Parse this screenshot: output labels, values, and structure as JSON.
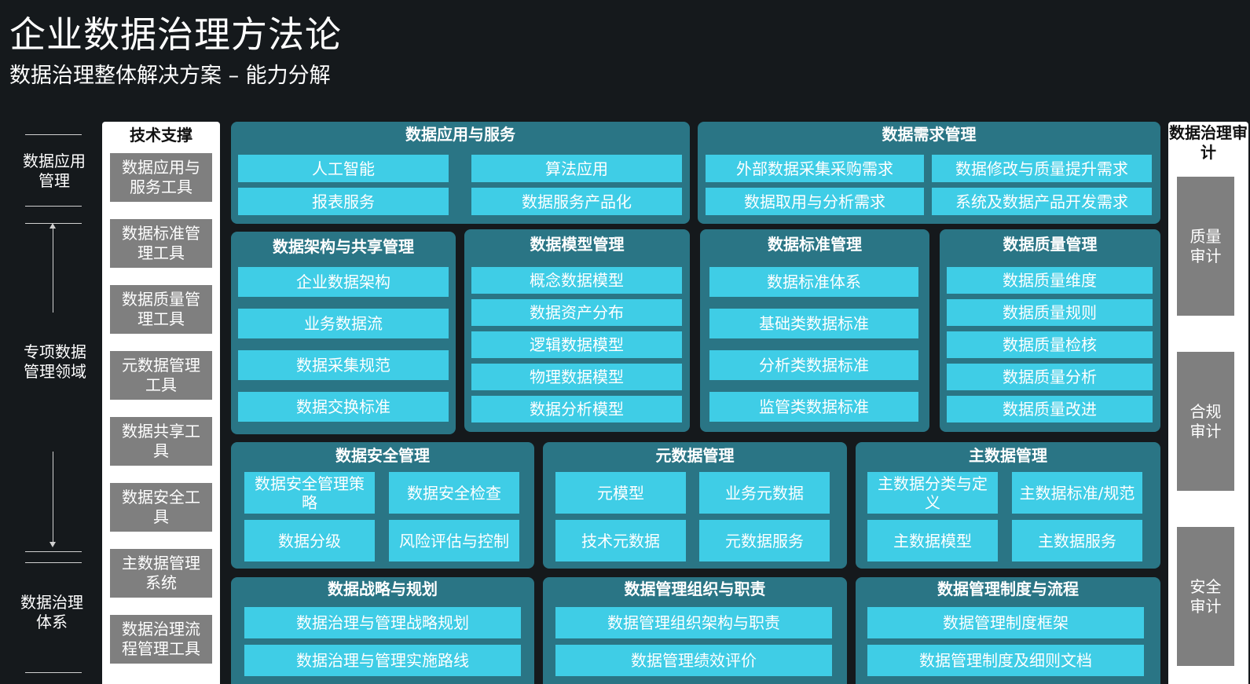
{
  "title": "企业数据治理方法论",
  "subtitle": "数据治理整体解决方案 – 能力分解",
  "axis": {
    "top_label": "数据应用管理",
    "middle_label": "专项数据管理领域",
    "bottom_label": "数据治理体系"
  },
  "tech_support": {
    "header": "技术支撑",
    "items": [
      "数据应用与服务工具",
      "数据标准管理工具",
      "数据质量管理工具",
      "元数据管理工具",
      "数据共享工具",
      "数据安全工具",
      "主数据管理系统",
      "数据治理流程管理工具"
    ]
  },
  "audit": {
    "header": "数据治理审计",
    "items": [
      "质量审计",
      "合规审计",
      "安全审计"
    ]
  },
  "panels": {
    "app_service": {
      "title": "数据应用与服务",
      "items": [
        "人工智能",
        "算法应用",
        "报表服务",
        "数据服务产品化"
      ]
    },
    "demand": {
      "title": "数据需求管理",
      "items": [
        "外部数据采集采购需求",
        "数据修改与质量提升需求",
        "数据取用与分析需求",
        "系统及数据产品开发需求"
      ]
    },
    "architecture": {
      "title": "数据架构与共享管理",
      "items": [
        "企业数据架构",
        "业务数据流",
        "数据采集规范",
        "数据交换标准"
      ]
    },
    "model": {
      "title": "数据模型管理",
      "items": [
        "概念数据模型",
        "数据资产分布",
        "逻辑数据模型",
        "物理数据模型",
        "数据分析模型"
      ]
    },
    "standard": {
      "title": "数据标准管理",
      "items": [
        "数据标准体系",
        "基础类数据标准",
        "分析类数据标准",
        "监管类数据标准"
      ]
    },
    "quality": {
      "title": "数据质量管理",
      "items": [
        "数据质量维度",
        "数据质量规则",
        "数据质量检核",
        "数据质量分析",
        "数据质量改进"
      ]
    },
    "security": {
      "title": "数据安全管理",
      "items": [
        "数据安全管理策略",
        "数据安全检查",
        "数据分级",
        "风险评估与控制"
      ]
    },
    "metadata": {
      "title": "元数据管理",
      "items": [
        "元模型",
        "业务元数据",
        "技术元数据",
        "元数据服务"
      ]
    },
    "master": {
      "title": "主数据管理",
      "items": [
        "主数据分类与定义",
        "主数据标准/规范",
        "主数据模型",
        "主数据服务"
      ]
    },
    "strategy": {
      "title": "数据战略与规划",
      "items": [
        "数据治理与管理战略规划",
        "数据治理与管理实施路线"
      ]
    },
    "organization": {
      "title": "数据管理组织与职责",
      "items": [
        "数据管理组织架构与职责",
        "数据管理绩效评价"
      ]
    },
    "policy": {
      "title": "数据管理制度与流程",
      "items": [
        "数据管理制度框架",
        "数据管理制度及细则文档"
      ]
    }
  },
  "colors": {
    "background": "#15191c",
    "panel": "#2a7585",
    "cell": "#3fcde6",
    "gray_box": "#7f7f7f",
    "white_column": "#ffffff"
  }
}
